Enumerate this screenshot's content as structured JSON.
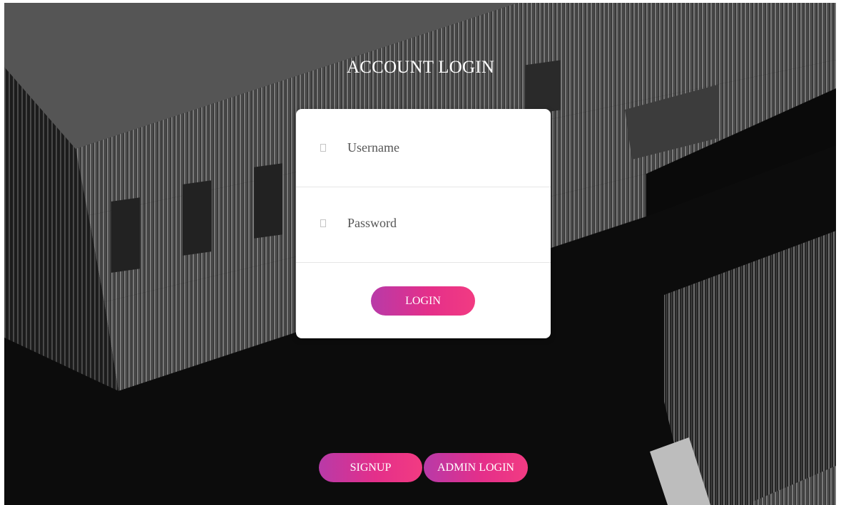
{
  "page": {
    "title": "ACCOUNT LOGIN"
  },
  "form": {
    "username_placeholder": "Username",
    "password_placeholder": "Password",
    "username_icon": "user-icon",
    "password_icon": "lock-icon",
    "login_label": "LOGIN"
  },
  "footer": {
    "signup_label": "SIGNUP",
    "admin_login_label": "ADMIN LOGIN"
  },
  "colors": {
    "button_gradient_start": "#b83aa8",
    "button_gradient_end": "#f23b82",
    "card_background": "#ffffff",
    "page_background": "#0a0a0a"
  }
}
